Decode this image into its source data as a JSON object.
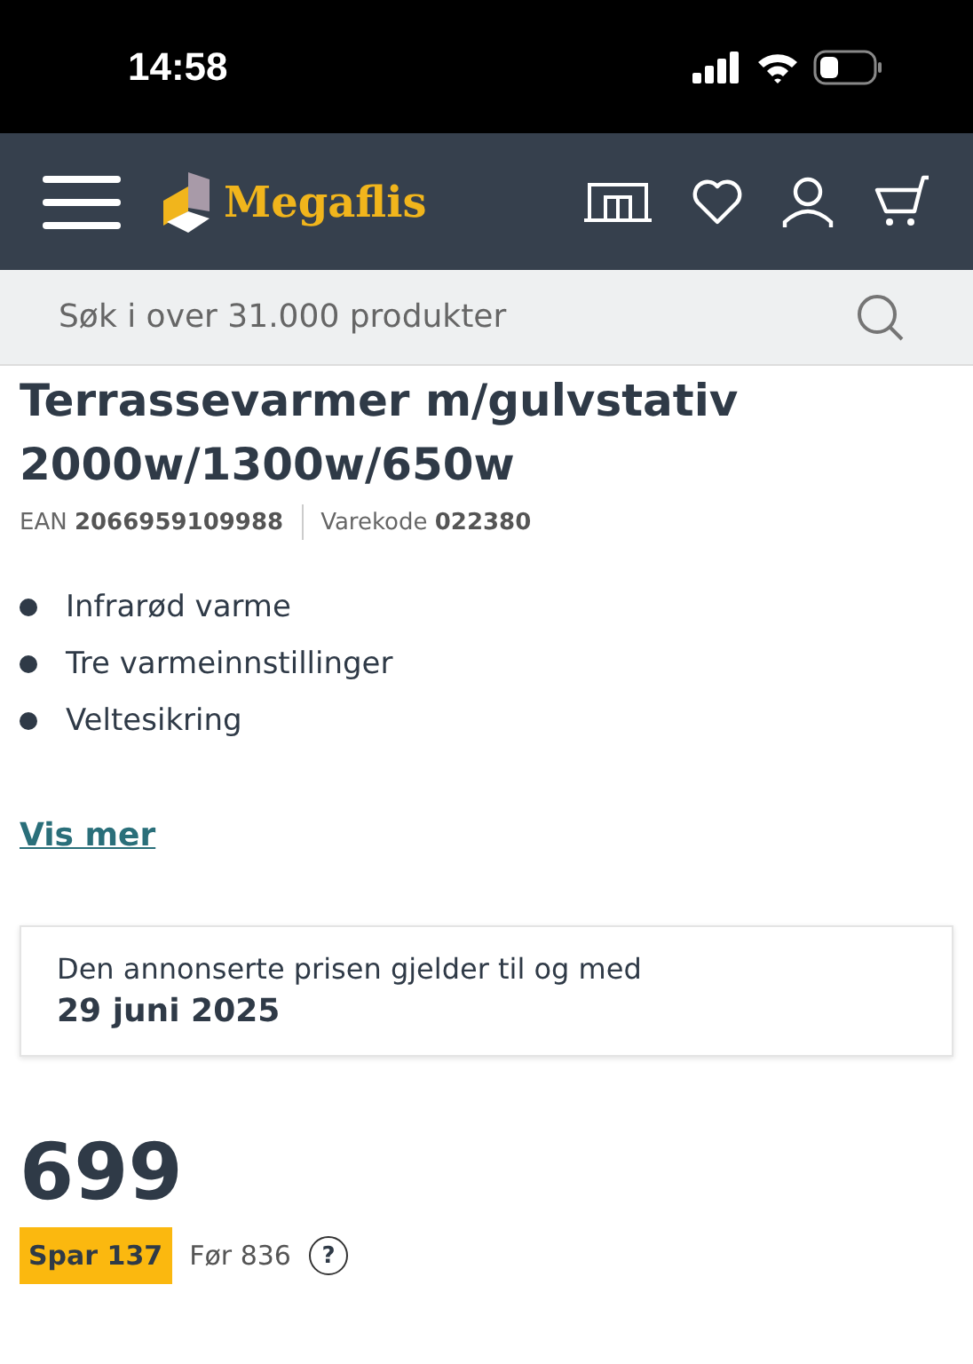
{
  "status_bar": {
    "time": "14:58"
  },
  "header": {
    "logo_text": "Megaflis"
  },
  "search": {
    "placeholder": "Søk i over 31.000 produkter"
  },
  "product": {
    "title": "Terrassevarmer m/gulvstativ 2000w/1300w/650w",
    "ean_label": "EAN",
    "ean": "2066959109988",
    "code_label": "Varekode",
    "code": "022380",
    "features": [
      "Infrarød varme",
      "Tre varmeinnstillinger",
      "Veltesikring"
    ],
    "more_link": "Vis mer"
  },
  "notice": {
    "text": "Den annonserte prisen gjelder til og med",
    "date": "29 juni 2025"
  },
  "price": {
    "amount": "699",
    "save_badge": "Spar 137",
    "before": "Før 836",
    "help": "?"
  }
}
